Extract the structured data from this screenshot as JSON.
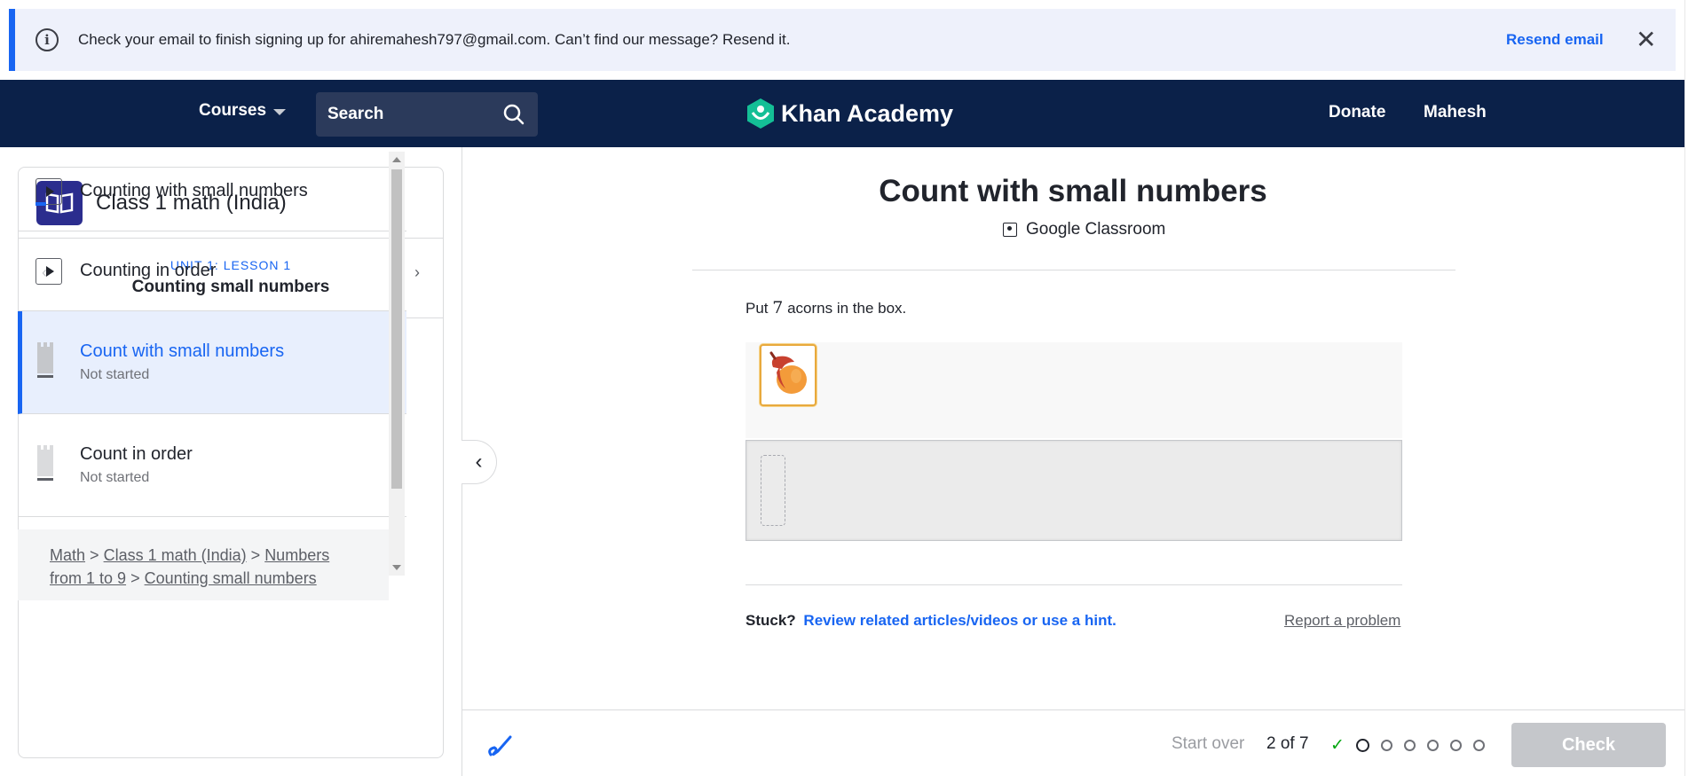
{
  "banner": {
    "message": "Check your email to finish signing up for ahiremahesh797@gmail.com. Can’t find our message? Resend it.",
    "resend_label": "Resend email",
    "close_glyph": "✕",
    "info_glyph": "i"
  },
  "nav": {
    "courses_label": "Courses",
    "search_placeholder": "Search",
    "brand": "Khan Academy",
    "donate_label": "Donate",
    "user_label": "Mahesh"
  },
  "sidebar": {
    "course_title": "Class 1 math (India)",
    "unit_label": "UNIT 1: LESSON 1",
    "lesson_title": "Counting small numbers",
    "prev_glyph": "‹",
    "next_glyph": "›",
    "items": [
      {
        "title": "Counting with small numbers",
        "subtitle": "",
        "type": "video"
      },
      {
        "title": "Counting in order",
        "subtitle": "",
        "type": "video"
      },
      {
        "title": "Count with small numbers",
        "subtitle": "Not started",
        "type": "exercise"
      },
      {
        "title": "Count in order",
        "subtitle": "Not started",
        "type": "exercise"
      }
    ],
    "breadcrumb": {
      "math": "Math",
      "sep": ">",
      "course": "Class 1 math (India)",
      "unit": "Numbers",
      "unit_cont": "from 1 to 9",
      "lesson": "Counting small numbers"
    }
  },
  "main": {
    "collapse_glyph": "‹",
    "title": "Count with small numbers",
    "google_classroom": "Google Classroom",
    "question_prefix": "Put",
    "question_number": "7",
    "question_suffix": "acorns in the box.",
    "stuck_label": "Stuck?",
    "hint_label": "Review related articles/videos or use a hint.",
    "report_label": "Report a problem"
  },
  "footer": {
    "start_over": "Start over",
    "progress": "2 of 7",
    "check_label": "Check",
    "progress_mark": "✓"
  },
  "colors": {
    "nav_bg": "#0b2149",
    "accent": "#1865f2",
    "banner_bg": "#eef1fb",
    "check_disabled": "#c5c7cb",
    "success": "#00a60e"
  }
}
